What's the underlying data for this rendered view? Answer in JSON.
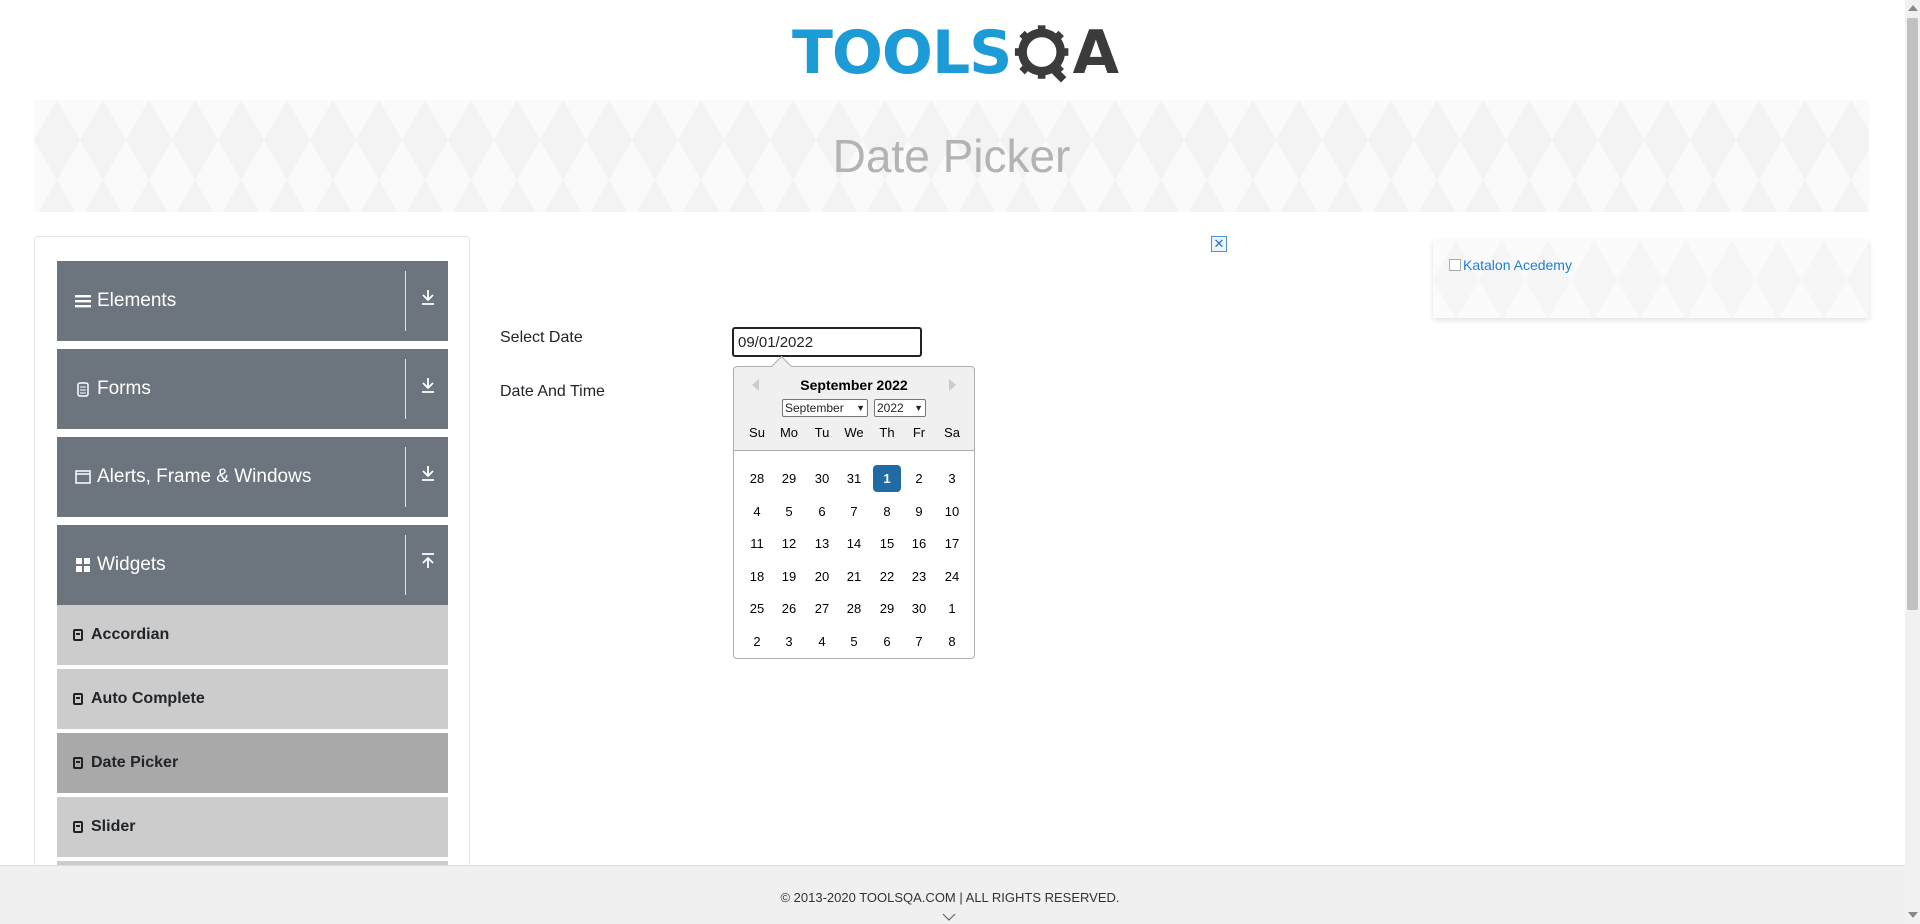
{
  "header": {
    "logo_part1": "TOOLS",
    "logo_part2": "Q",
    "logo_part3": "A"
  },
  "banner": {
    "title": "Date Picker"
  },
  "sidebar": {
    "groups": [
      {
        "label": "Elements",
        "icon": "hamburger-icon",
        "expanded": false
      },
      {
        "label": "Forms",
        "icon": "document-icon",
        "expanded": false
      },
      {
        "label": "Alerts, Frame & Windows",
        "icon": "window-icon",
        "expanded": false
      },
      {
        "label": "Widgets",
        "icon": "grid-icon",
        "expanded": true
      }
    ],
    "widget_items": [
      {
        "label": "Accordian"
      },
      {
        "label": "Auto Complete"
      },
      {
        "label": "Date Picker",
        "active": true
      },
      {
        "label": "Slider"
      }
    ]
  },
  "ad": {
    "close_symbol": "✕",
    "right_ad_alt": "Katalon Acedemy"
  },
  "form": {
    "select_date_label": "Select Date",
    "date_time_label": "Date And Time",
    "date_value": "09/01/2022"
  },
  "calendar": {
    "title": "September 2022",
    "month_select": "September",
    "year_select": "2022",
    "weekdays": [
      "Su",
      "Mo",
      "Tu",
      "We",
      "Th",
      "Fr",
      "Sa"
    ],
    "weeks": [
      [
        "28",
        "29",
        "30",
        "31",
        "1",
        "2",
        "3"
      ],
      [
        "4",
        "5",
        "6",
        "7",
        "8",
        "9",
        "10"
      ],
      [
        "11",
        "12",
        "13",
        "14",
        "15",
        "16",
        "17"
      ],
      [
        "18",
        "19",
        "20",
        "21",
        "22",
        "23",
        "24"
      ],
      [
        "25",
        "26",
        "27",
        "28",
        "29",
        "30",
        "1"
      ],
      [
        "2",
        "3",
        "4",
        "5",
        "6",
        "7",
        "8"
      ]
    ],
    "selected": "1",
    "selected_color": "#216ba5"
  },
  "footer": {
    "copyright": "© 2013-2020 TOOLSQA.COM | ALL RIGHTS RESERVED."
  },
  "colors": {
    "sidebar_header": "#6c757d",
    "sub_item": "#cccccc",
    "sub_item_active": "#a9a9a9",
    "brand_blue": "#1d9bd6"
  }
}
